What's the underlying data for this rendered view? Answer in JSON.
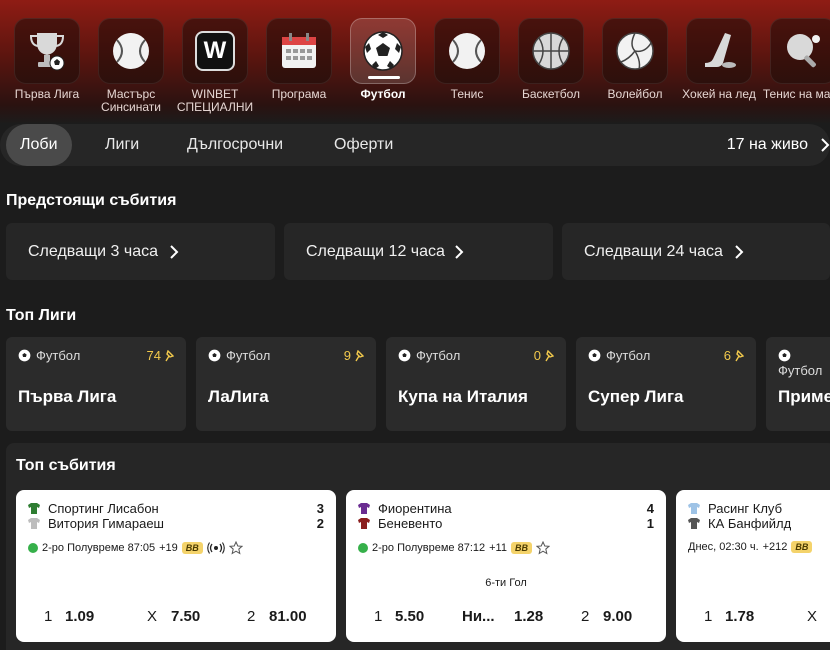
{
  "sports": [
    {
      "label": "Първа Лига",
      "icon": "trophy-icon"
    },
    {
      "label": "Мастърс Синсинати",
      "icon": "tennis-ball-icon"
    },
    {
      "label": "WINBET СПЕЦИАЛНИ",
      "icon": "winbet-logo-icon"
    },
    {
      "label": "Програма",
      "icon": "calendar-icon"
    },
    {
      "label": "Футбол",
      "icon": "football-icon",
      "active": true
    },
    {
      "label": "Тенис",
      "icon": "tennis-ball-icon"
    },
    {
      "label": "Баскетбол",
      "icon": "basketball-icon"
    },
    {
      "label": "Волейбол",
      "icon": "volleyball-icon"
    },
    {
      "label": "Хокей на лед",
      "icon": "hockey-icon"
    },
    {
      "label": "Тенис на маса",
      "icon": "table-tennis-icon"
    }
  ],
  "winbet_logo_letter": "W",
  "tabs": {
    "lobby": "Лоби",
    "leagues": "Лиги",
    "longterm": "Дългосрочни",
    "offers": "Оферти",
    "live": "17 на живо"
  },
  "upcoming": {
    "title": "Предстоящи събития",
    "items": [
      "Следващи 3 часа",
      "Следващи 12 часа",
      "Следващи 24 часа"
    ]
  },
  "top_leagues": {
    "title": "Топ Лиги",
    "items": [
      {
        "sport": "Футбол",
        "count": "74",
        "name": "Първа Лига"
      },
      {
        "sport": "Футбол",
        "count": "9",
        "name": "ЛаЛига"
      },
      {
        "sport": "Футбол",
        "count": "0",
        "name": "Купа на Италия"
      },
      {
        "sport": "Футбол",
        "count": "6",
        "name": "Супер Лига"
      },
      {
        "sport": "Футбол",
        "count": "",
        "name": "Приме"
      }
    ]
  },
  "top_events": {
    "title": "Топ събития",
    "cards": [
      {
        "home": "Спортинг Лисабон",
        "away": "Витория Гимараеш",
        "home_score": "3",
        "away_score": "2",
        "status": "2-ро Полувреме 87:05",
        "markets": "+19",
        "badge": "BB",
        "note": "",
        "odds": [
          {
            "k": "1",
            "v": "1.09"
          },
          {
            "k": "X",
            "v": "7.50"
          },
          {
            "k": "2",
            "v": "81.00"
          }
        ],
        "home_kit": "#2e7d32",
        "away_kit": "#cccccc",
        "live": true
      },
      {
        "home": "Фиорентина",
        "away": "Беневенто",
        "home_score": "4",
        "away_score": "1",
        "status": "2-ро Полувреме 87:12",
        "markets": "+11",
        "badge": "BB",
        "note": "6-ти Гол",
        "odds": [
          {
            "k": "1",
            "v": "5.50"
          },
          {
            "k": "Ни...",
            "v": "1.28"
          },
          {
            "k": "2",
            "v": "9.00"
          }
        ],
        "home_kit": "#6a2c91",
        "away_kit": "#8b1e1e",
        "live": true
      },
      {
        "home": "Расинг Клуб",
        "away": "КА Банфийлд",
        "home_score": "",
        "away_score": "",
        "status": "Днес, 02:30 ч.",
        "markets": "+212",
        "badge": "BB",
        "note": "",
        "odds": [
          {
            "k": "1",
            "v": "1.78"
          },
          {
            "k": "X",
            "v": ""
          },
          {
            "k": "",
            "v": ""
          }
        ],
        "home_kit": "#9ec3e6",
        "away_kit": "#555555",
        "live": false
      }
    ]
  }
}
